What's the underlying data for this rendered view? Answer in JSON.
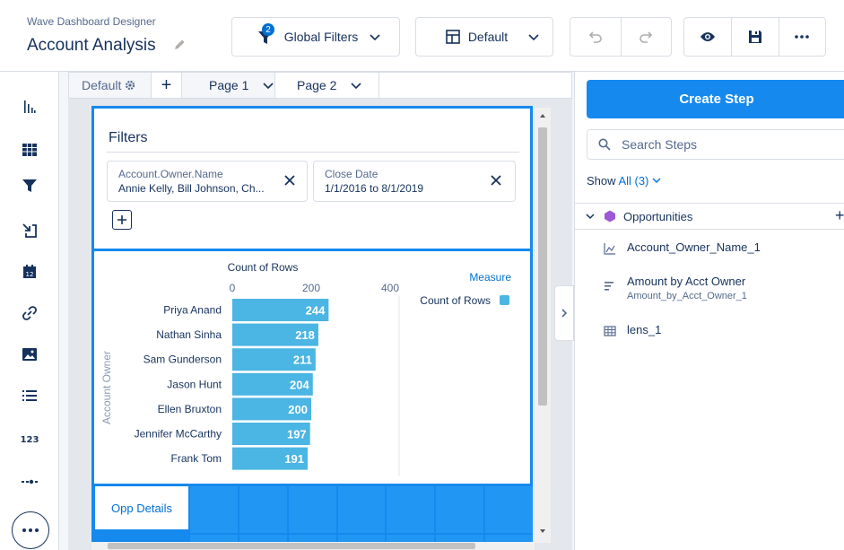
{
  "header": {
    "app_name": "Wave Dashboard Designer",
    "dashboard_title": "Account Analysis",
    "global_filters_label": "Global Filters",
    "global_filters_badge": "2",
    "layout_label": "Default"
  },
  "tabs": {
    "default_label": "Default",
    "add_label": "+",
    "pages": [
      {
        "label": "Page 1"
      },
      {
        "label": "Page 2"
      }
    ]
  },
  "filters_widget": {
    "title": "Filters",
    "cards": [
      {
        "field": "Account.Owner.Name",
        "value": "Annie Kelly, Bill Johnson, Ch..."
      },
      {
        "field": "Close Date",
        "value": "1/1/2016 to 8/1/2019"
      }
    ]
  },
  "chart_data": {
    "type": "bar",
    "orientation": "horizontal",
    "title": "Count of Rows",
    "ylabel": "Account Owner",
    "categories": [
      "Priya Anand",
      "Nathan Sinha",
      "Sam Gunderson",
      "Jason Hunt",
      "Ellen Bruxton",
      "Jennifer McCarthy",
      "Frank Tom"
    ],
    "values": [
      244,
      218,
      211,
      204,
      200,
      197,
      191
    ],
    "xlim": [
      0,
      400
    ],
    "xticks": [
      0,
      200,
      400
    ],
    "legend_title": "Measure",
    "legend": [
      {
        "name": "Count of Rows",
        "color": "#4bb5e3"
      }
    ],
    "legend_position": "top-right",
    "bar_color": "#4bb5e3"
  },
  "table_widget": {
    "label": "Opp Details"
  },
  "right_panel": {
    "create_step_label": "Create Step",
    "search_placeholder": "Search Steps",
    "show_label": "Show",
    "show_link": "All (3)",
    "section_name": "Opportunities",
    "section_plus": "+",
    "steps": [
      {
        "name": "Account_Owner_Name_1",
        "sub": "",
        "icon": "chart-icon"
      },
      {
        "name": "Amount by Acct Owner",
        "sub": "Amount_by_Acct_Owner_1",
        "icon": "compare-table-icon"
      },
      {
        "name": "lens_1",
        "sub": "",
        "icon": "table-icon"
      }
    ]
  }
}
